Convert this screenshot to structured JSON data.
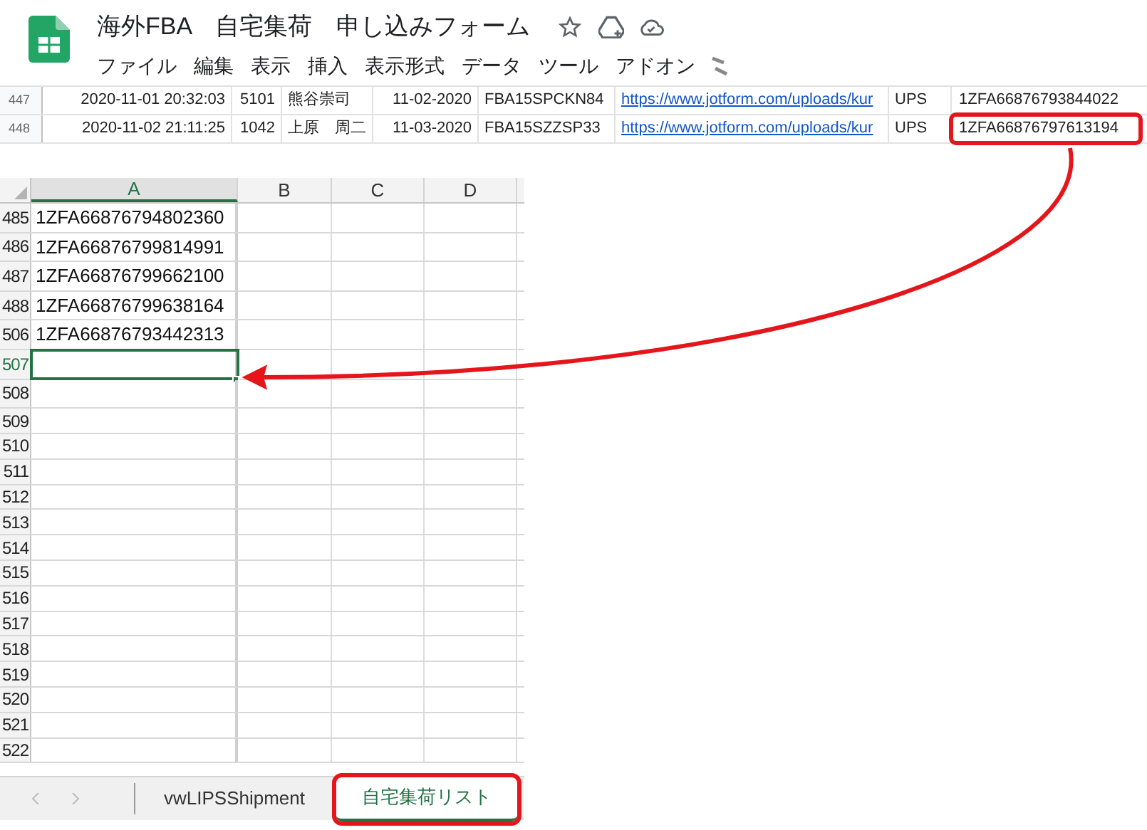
{
  "app_header": {
    "title": "海外FBA　自宅集荷　申し込みフォーム",
    "menu": [
      "ファイル",
      "編集",
      "表示",
      "挿入",
      "表示形式",
      "データ",
      "ツール",
      "アドオン"
    ]
  },
  "top_grid": {
    "rows": [
      {
        "row": "447",
        "cells": [
          "2020-11-01 20:32:03",
          "5101",
          "熊谷崇司",
          "11-02-2020",
          "FBA15SPCKN84",
          "https://www.jotform.com/uploads/kur",
          "UPS"
        ],
        "tracking": "1ZFA66876793844022",
        "tracking_highlighted": false
      },
      {
        "row": "448",
        "cells": [
          "2020-11-02 21:11:25",
          "1042",
          "上原　周二",
          "11-03-2020",
          "FBA15SZZSP33",
          "https://www.jotform.com/uploads/kur",
          "UPS"
        ],
        "tracking": "1ZFA66876797613194",
        "tracking_highlighted": true
      }
    ]
  },
  "sheet": {
    "columns": [
      {
        "label": "A",
        "selected": true
      },
      {
        "label": "B",
        "selected": false
      },
      {
        "label": "C",
        "selected": false
      },
      {
        "label": "D",
        "selected": false
      }
    ],
    "rows": [
      {
        "row": "485",
        "value": "1ZFA66876794802360",
        "selected": false
      },
      {
        "row": "486",
        "value": "1ZFA66876799814991",
        "selected": false
      },
      {
        "row": "487",
        "value": "1ZFA66876799662100",
        "selected": false
      },
      {
        "row": "488",
        "value": "1ZFA66876799638164",
        "selected": false
      },
      {
        "row": "506",
        "value": "1ZFA66876793442313",
        "selected": false
      },
      {
        "row": "507",
        "selected": true
      },
      {
        "row": "508",
        "selected": false
      },
      {
        "row": "509",
        "selected": false
      },
      {
        "row": "510",
        "selected": false
      },
      {
        "row": "511",
        "selected": false
      },
      {
        "row": "512",
        "selected": false
      },
      {
        "row": "513",
        "selected": false
      },
      {
        "row": "514",
        "selected": false
      },
      {
        "row": "515",
        "selected": false
      },
      {
        "row": "516",
        "selected": false
      },
      {
        "row": "517",
        "selected": false
      },
      {
        "row": "518",
        "selected": false
      },
      {
        "row": "519",
        "selected": false
      },
      {
        "row": "520",
        "selected": false
      },
      {
        "row": "521",
        "selected": false
      },
      {
        "row": "522",
        "selected": false
      }
    ]
  },
  "sheet_tabs": [
    {
      "label": "vwLIPSShipment",
      "selected": false,
      "highlighted": false
    },
    {
      "label": "自宅集荷リスト",
      "selected": true,
      "highlighted": true
    }
  ]
}
